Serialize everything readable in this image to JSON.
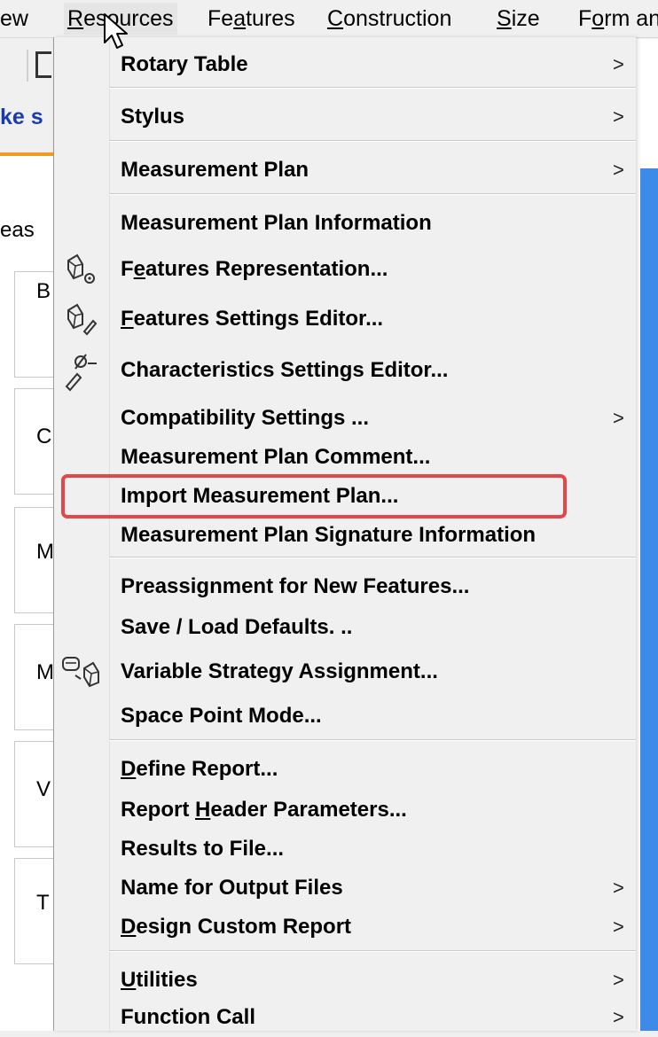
{
  "menubar": {
    "items": [
      {
        "pre": "ew",
        "ul": "",
        "post": ""
      },
      {
        "pre": "",
        "ul": "R",
        "post": "esources"
      },
      {
        "pre": "Fe",
        "ul": "a",
        "post": "tures"
      },
      {
        "pre": "",
        "ul": "C",
        "post": "onstruction"
      },
      {
        "pre": "",
        "ul": "S",
        "post": "ize"
      },
      {
        "pre": "F",
        "ul": "o",
        "post": "rm an"
      }
    ]
  },
  "background": {
    "link_fragment": "ke s",
    "meas_fragment": "eas",
    "box_letters": [
      "B",
      "C",
      "M",
      "M",
      "V",
      "T"
    ]
  },
  "menu": {
    "items": [
      {
        "label": "Rotary Table",
        "submenu": true
      },
      {
        "label": "Stylus",
        "submenu": true
      },
      {
        "label": "Measurement Plan",
        "submenu": true
      },
      {
        "label": "Measurement Plan Information",
        "submenu": false
      },
      {
        "label_pre": "F",
        "label_ul": "e",
        "label_post": "atures Representation...",
        "submenu": false,
        "icon": "features-representation-icon"
      },
      {
        "label_pre": "",
        "label_ul": "F",
        "label_post": "eatures Settings Editor...",
        "submenu": false,
        "icon": "features-settings-editor-icon"
      },
      {
        "label": "Characteristics Settings Editor...",
        "submenu": false,
        "icon": "characteristics-settings-icon"
      },
      {
        "label": "Compatibility Settings ...",
        "submenu": true
      },
      {
        "label": "Measurement Plan Comment...",
        "submenu": false
      },
      {
        "label": "Import Measurement Plan...",
        "submenu": false,
        "highlighted": true
      },
      {
        "label": "Measurement Plan Signature Information",
        "submenu": false
      },
      {
        "label": "Preassignment for New Features...",
        "submenu": false
      },
      {
        "label": "Save / Load Defaults. ..",
        "submenu": false
      },
      {
        "label": "Variable Strategy Assignment...",
        "submenu": false,
        "icon": "variable-strategy-icon"
      },
      {
        "label": "Space Point Mode...",
        "submenu": false
      },
      {
        "label_pre": "",
        "label_ul": "D",
        "label_post": "efine Report...",
        "submenu": false
      },
      {
        "label_pre": "Report ",
        "label_ul": "H",
        "label_post": "eader Parameters...",
        "submenu": false
      },
      {
        "label": "Results to File...",
        "submenu": false
      },
      {
        "label": "Name for Output Files",
        "submenu": true
      },
      {
        "label_pre": "",
        "label_ul": "D",
        "label_post": "esign Custom Report",
        "submenu": true
      },
      {
        "label_pre": "",
        "label_ul": "U",
        "label_post": "tilities",
        "submenu": true
      },
      {
        "label": "Function Call",
        "submenu": true
      }
    ],
    "submenu_arrow": ">"
  },
  "colors": {
    "highlight": "#e24848",
    "menu_bg": "#f0f0f0",
    "accent_blue": "#3d8be8",
    "link_blue": "#1a3caa",
    "orange": "#f29b1c"
  }
}
